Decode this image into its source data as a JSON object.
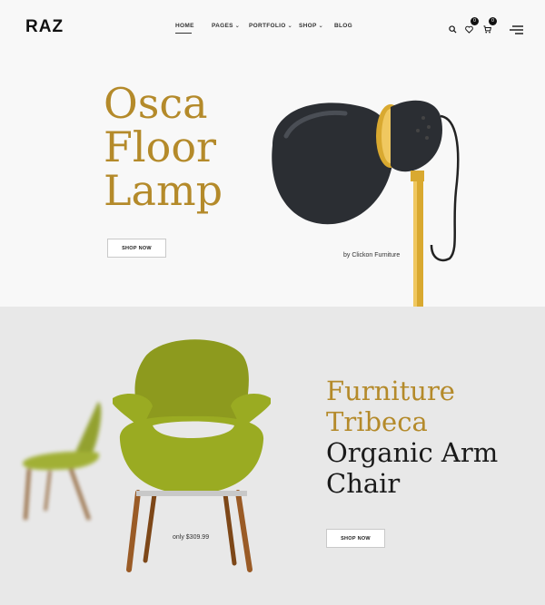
{
  "header": {
    "logo": "RAZ",
    "nav": [
      {
        "label": "HOME"
      },
      {
        "label": "PAGES"
      },
      {
        "label": "PORTFOLIO"
      },
      {
        "label": "SHOP"
      },
      {
        "label": "BLOG"
      }
    ],
    "icons": {
      "search": "search-icon",
      "wishlist": "heart-icon",
      "cart": "cart-icon",
      "menu": "menu-icon"
    },
    "wishlist_count": "0",
    "cart_count": "0"
  },
  "hero1": {
    "title_lines": [
      "Osca",
      "Floor",
      "Lamp"
    ],
    "button_label": "SHOP NOW",
    "byline": "by Clickon Furniture"
  },
  "hero2": {
    "title_gold_lines": [
      "Furniture",
      "Tribeca"
    ],
    "title_dark_lines": [
      "Organic Arm",
      "Chair"
    ],
    "price": "only $309.99",
    "button_label": "SHOP NOW"
  },
  "colors": {
    "accent_gold": "#b48a2a",
    "dark": "#1a1a1a",
    "hero1_bg": "#f8f8f8",
    "hero2_bg": "#e8e8e8"
  }
}
